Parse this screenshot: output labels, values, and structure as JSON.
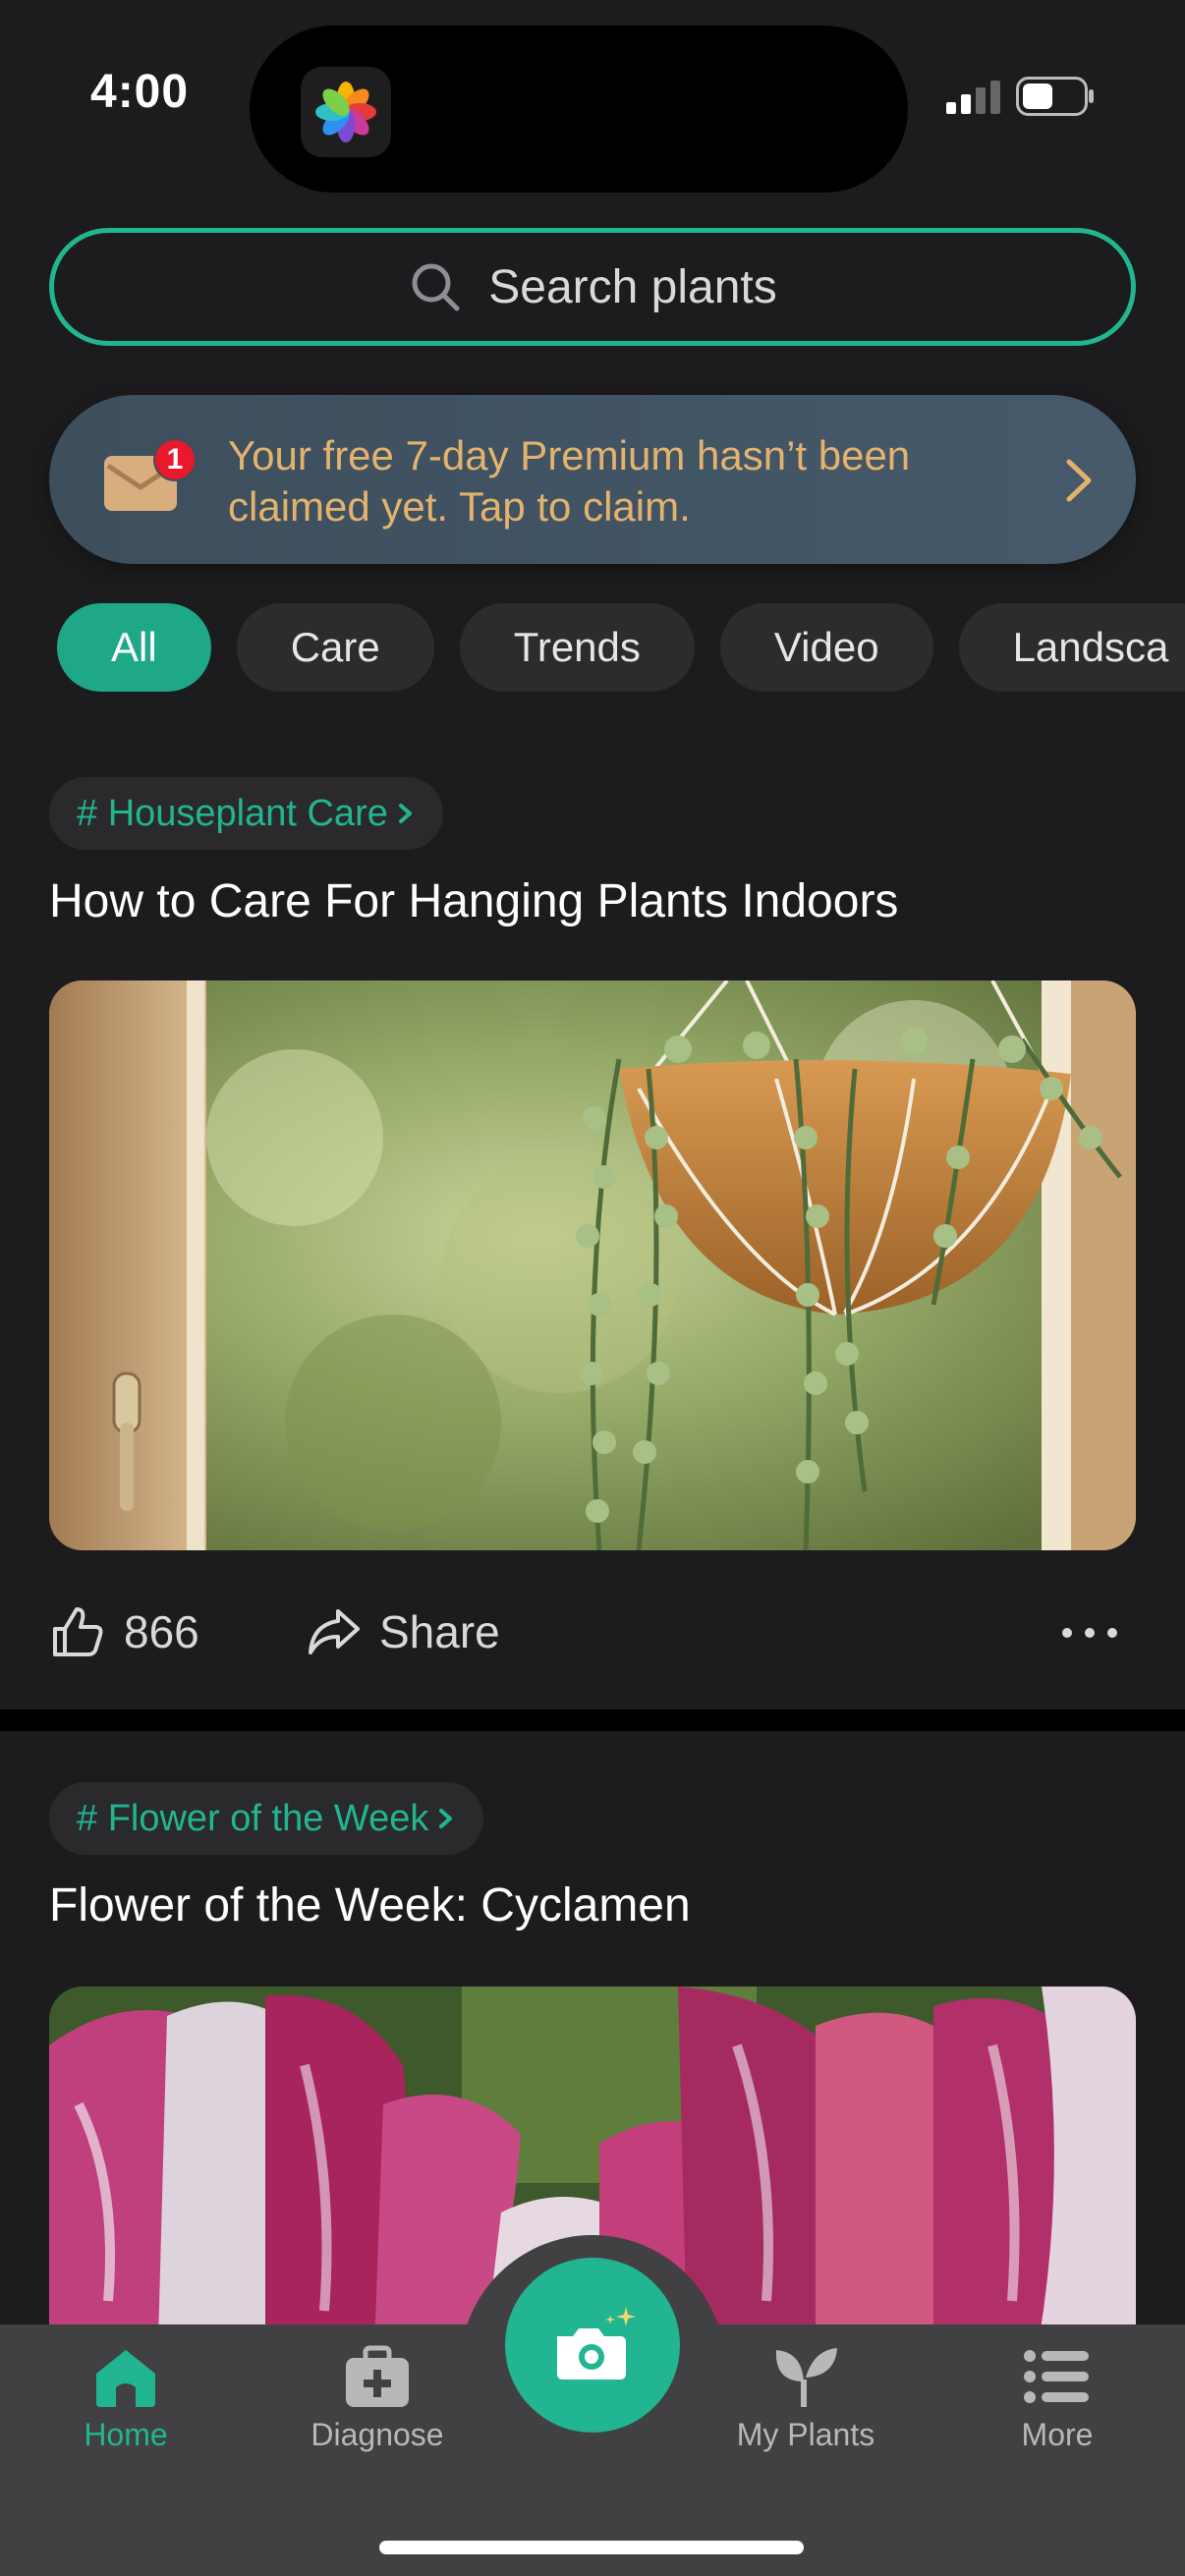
{
  "status": {
    "time": "4:00"
  },
  "search": {
    "placeholder": "Search plants"
  },
  "banner": {
    "badge": "1",
    "text": "Your free 7-day Premium hasn’t been claimed yet. Tap to claim."
  },
  "chips": [
    "All",
    "Care",
    "Trends",
    "Video",
    "Landsca"
  ],
  "articles": [
    {
      "tag": "# Houseplant Care",
      "title": "How to Care For Hanging Plants Indoors",
      "likes": "866",
      "share": "Share"
    },
    {
      "tag": "# Flower of the Week",
      "title": "Flower of the Week: Cyclamen"
    }
  ],
  "tabs": {
    "home": "Home",
    "diagnose": "Diagnose",
    "my_plants": "My Plants",
    "more": "More"
  },
  "colors": {
    "accent": "#22b591",
    "banner_text": "#e3b36e",
    "background": "#1c1c1e",
    "tabbar": "#414143"
  }
}
